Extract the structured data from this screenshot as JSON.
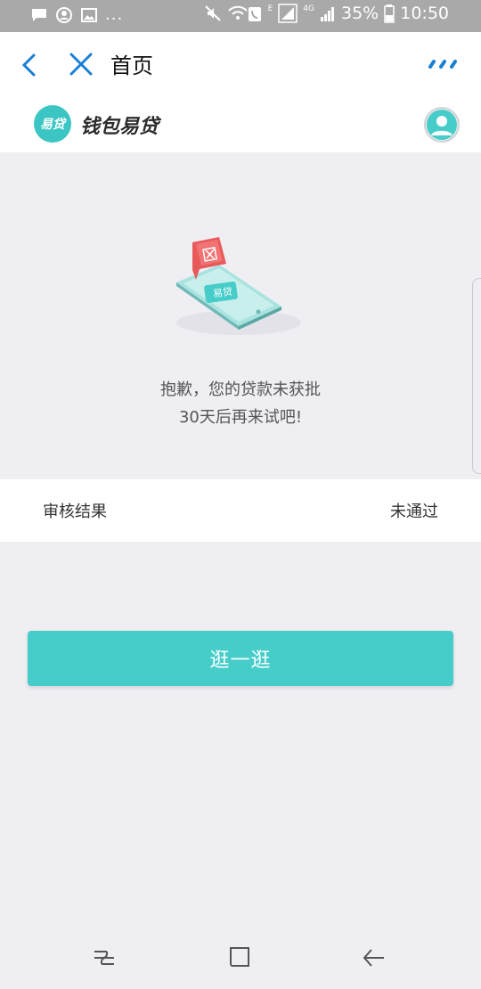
{
  "status_bar": {
    "battery": "35%",
    "time": "10:50",
    "more_dots": "...",
    "network_e": "E",
    "network_4g": "4G",
    "icons": [
      "chat-icon",
      "account-icon",
      "image-icon",
      "mute-icon",
      "wifi-call-icon",
      "signal-icon",
      "battery-icon"
    ]
  },
  "nav": {
    "title": "首页",
    "icons": [
      "back-icon",
      "close-icon",
      "more-icon"
    ],
    "accent_color": "#1a7fd6"
  },
  "brand": {
    "logo_text": "易贷",
    "name": "钱包易贷",
    "logo_color": "#3cc6c3"
  },
  "message": {
    "line1": "抱歉，您的贷款未获批",
    "line2": "30天后再来试吧!"
  },
  "illustration": {
    "phone_badge": "易贷"
  },
  "result": {
    "label": "审核结果",
    "value": "未通过"
  },
  "button": {
    "label": "逛一逛",
    "color": "#46cdc9"
  },
  "bottom_nav": {
    "icons": [
      "recent-apps-icon",
      "home-icon",
      "back-arrow-icon"
    ]
  }
}
